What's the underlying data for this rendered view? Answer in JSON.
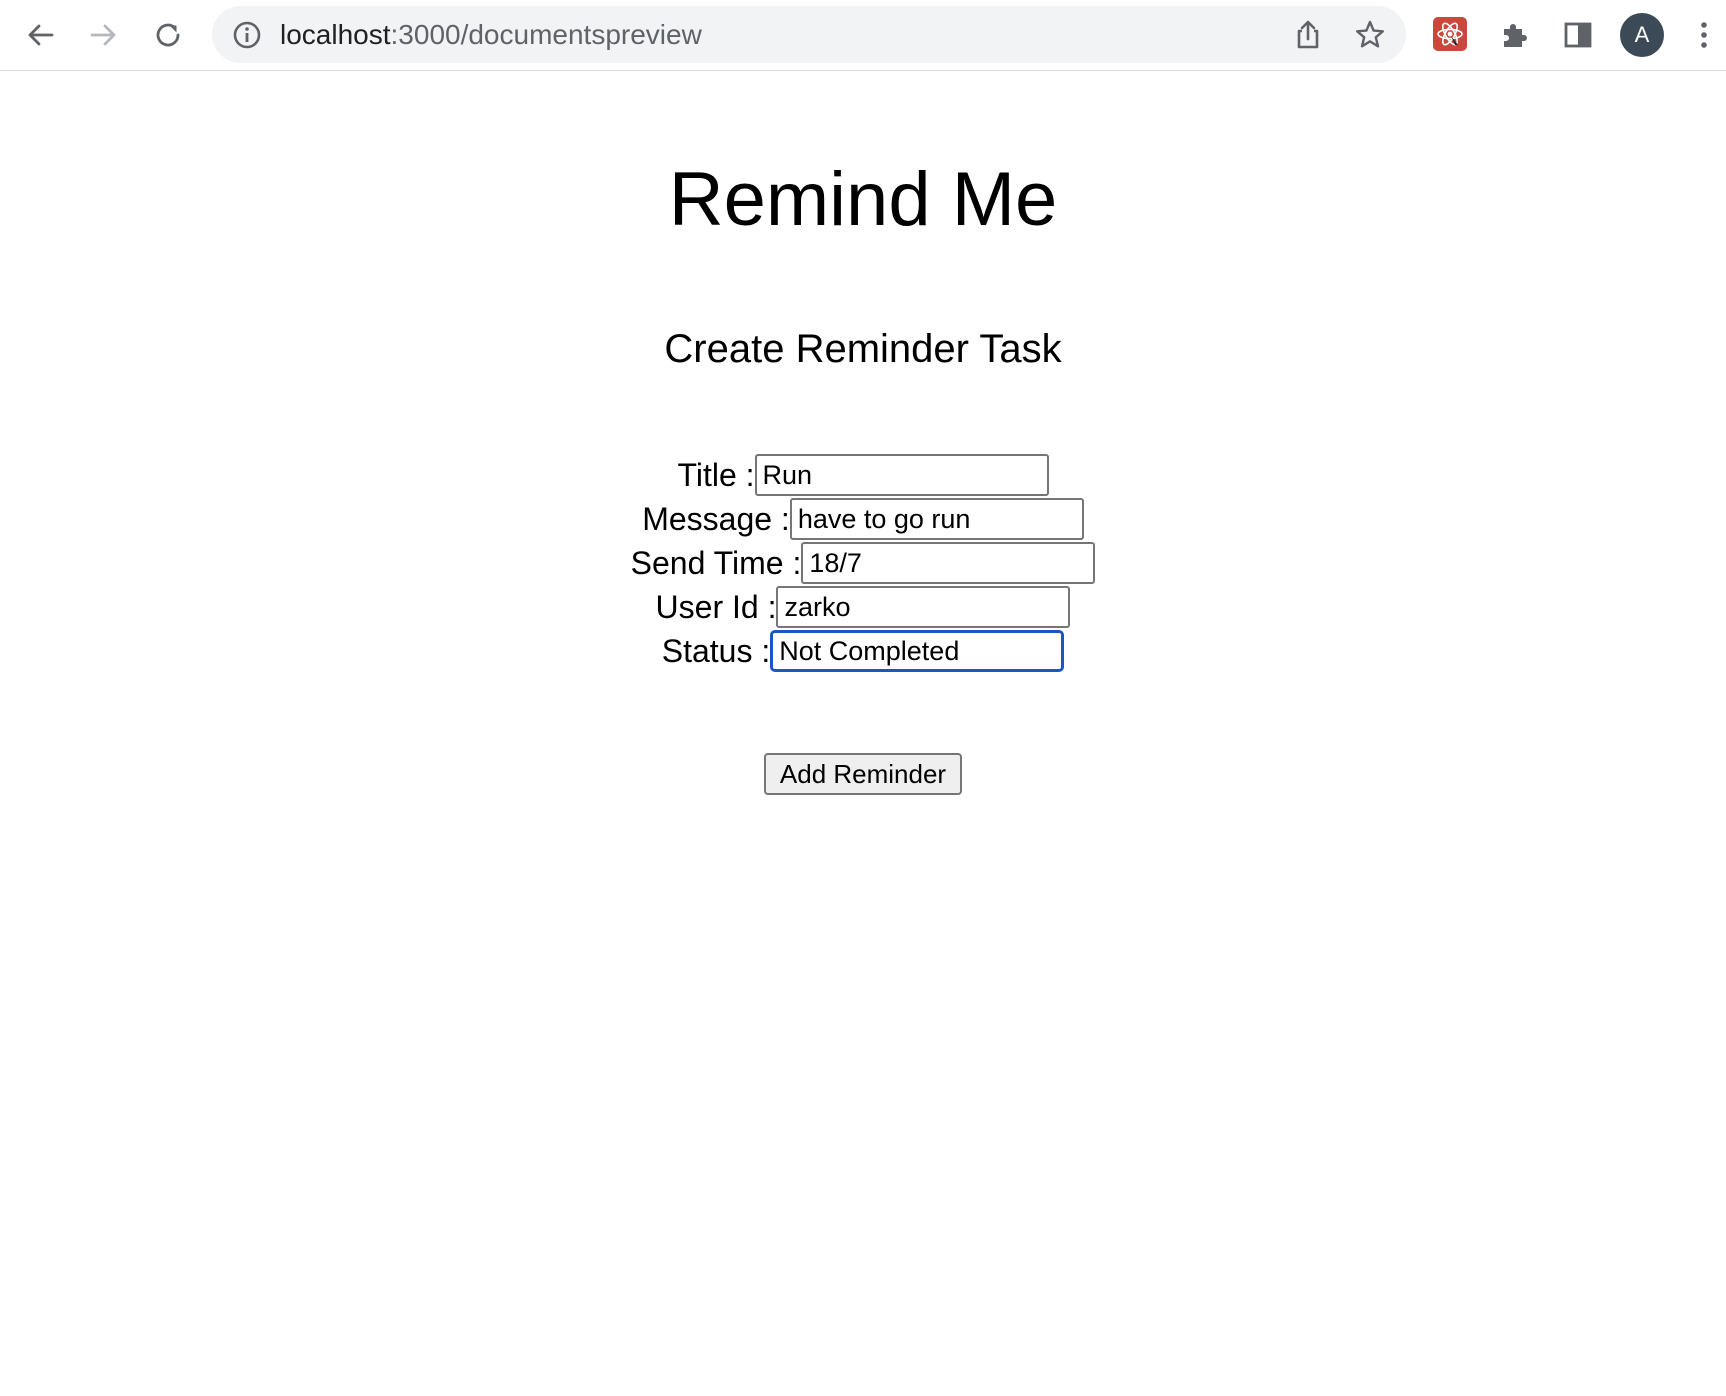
{
  "browser": {
    "url_host": "localhost",
    "url_rest": ":3000/documentspreview",
    "avatar_letter": "A",
    "icons": {
      "back": "arrow-left-icon",
      "forward": "arrow-right-icon",
      "reload": "reload-icon",
      "info": "info-icon",
      "share": "share-icon",
      "bookmark": "star-icon",
      "extension": "react-devtools-icon",
      "extensions_menu": "puzzle-icon",
      "side_panel": "side-panel-icon",
      "menu": "kebab-menu-icon"
    }
  },
  "page": {
    "title": "Remind Me",
    "subtitle": "Create Reminder Task",
    "form": {
      "fields": [
        {
          "label": "Title :",
          "value": "Run"
        },
        {
          "label": "Message :",
          "value": "have to go run"
        },
        {
          "label": "Send Time :",
          "value": "18/7"
        },
        {
          "label": "User Id :",
          "value": "zarko"
        },
        {
          "label": "Status :",
          "value": "Not Completed"
        }
      ],
      "submit_label": "Add Reminder"
    }
  },
  "colors": {
    "focus_ring": "#1a56c8",
    "omnibox_bg": "#f1f3f4",
    "avatar_bg": "#3c4a57",
    "react_ext_bg": "#c8483c"
  }
}
